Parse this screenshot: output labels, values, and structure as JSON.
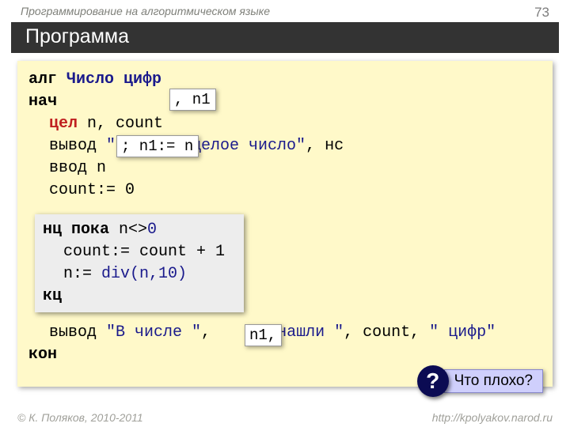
{
  "header": {
    "subject": "Программирование на алгоритмическом языке",
    "page": "73"
  },
  "title": "Программа",
  "code": {
    "alg": "алг",
    "name": "Число цифр",
    "nach": "нач",
    "decl_kw": "цел",
    "decl_rest": " n, count",
    "out1_kw": "вывод ",
    "out1_str": "\"Введите целое число\"",
    "out1_tail": ", нс",
    "in_kw": "ввод ",
    "in_var": "n",
    "assign0": "count:= 0",
    "loop_head_kw": "нц пока ",
    "loop_head_cond": "n<>",
    "loop_head_zero": "0",
    "loop_b1": "count:= count + 1",
    "loop_b2a": "n:= ",
    "loop_b2b": "div(n,10)",
    "loop_end": "кц",
    "out2_kw": "вывод ",
    "out2_s1": "\"В числе \"",
    "out2_c1": ", ",
    "out2_s2": "\" нашли \"",
    "out2_c2": ", count, ",
    "out2_s3": "\" цифр\"",
    "kon": "кон"
  },
  "callouts": {
    "c1": ", n1",
    "c2": "; n1:= n",
    "c3": "n1,"
  },
  "question": {
    "mark": "?",
    "text": "Что плохо?"
  },
  "footer": {
    "left": "© К. Поляков, 2010-2011",
    "right": "http://kpolyakov.narod.ru"
  }
}
